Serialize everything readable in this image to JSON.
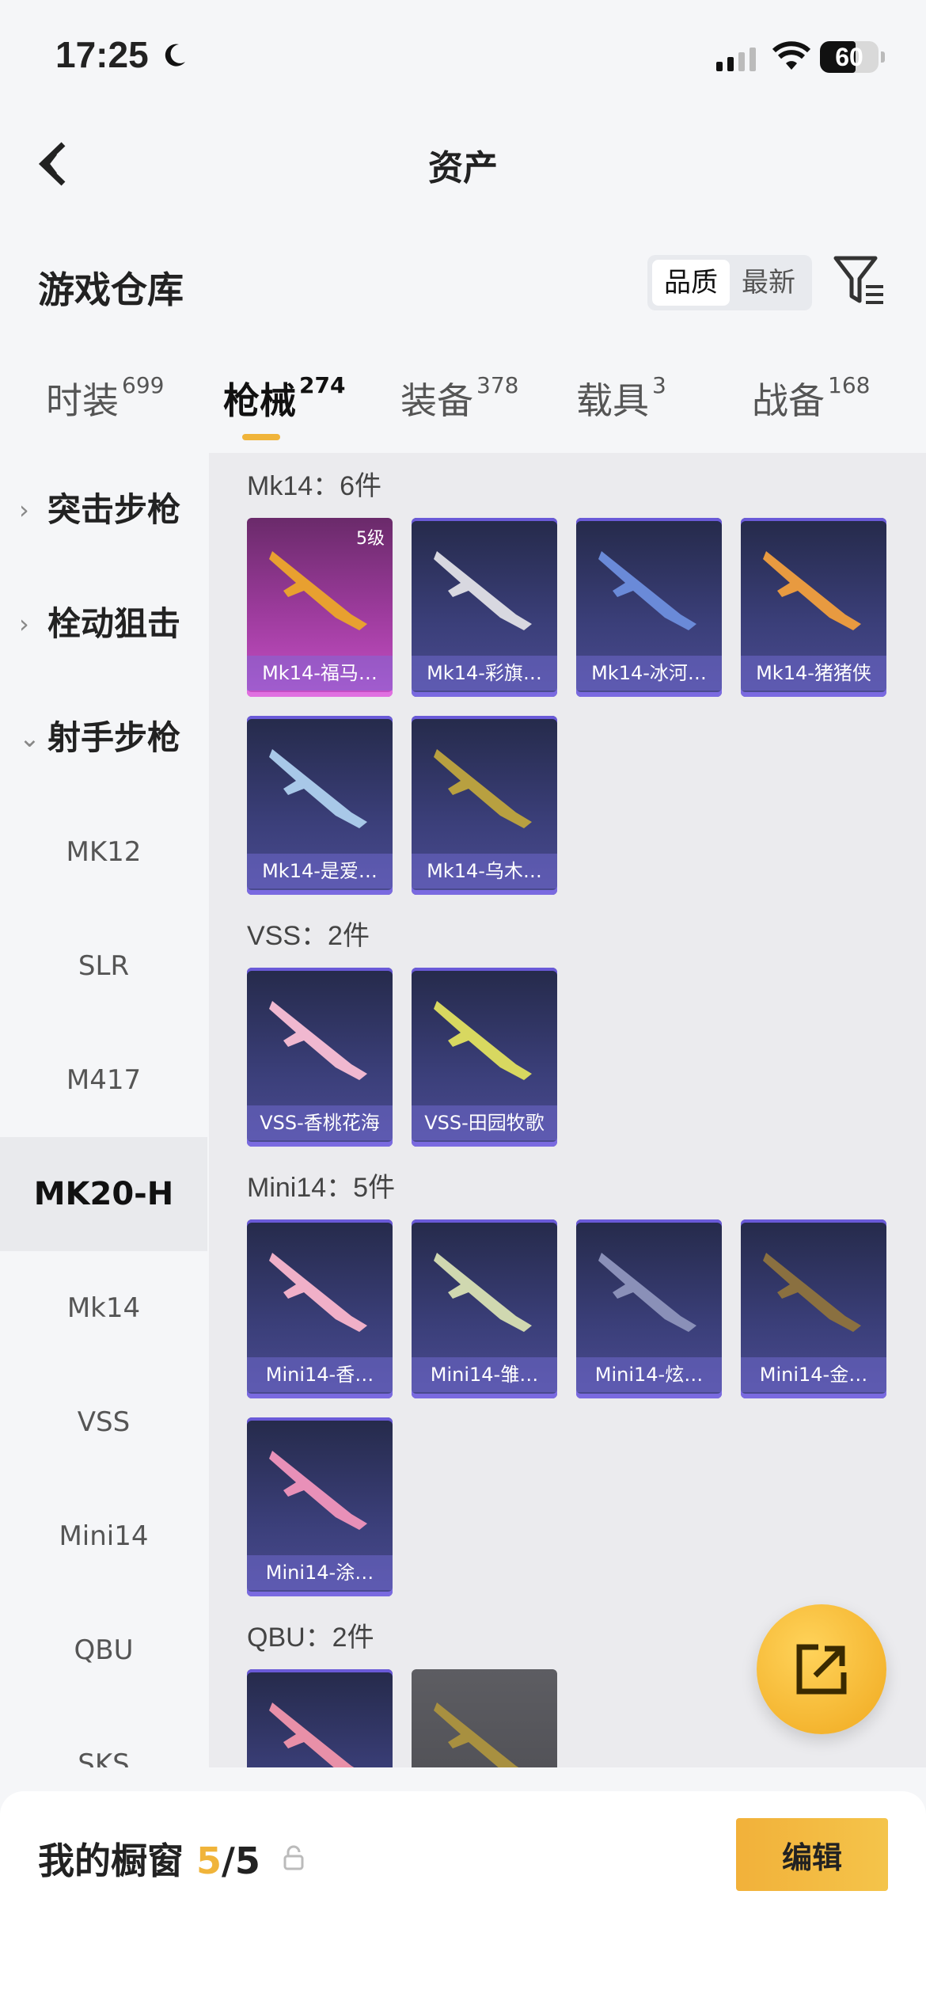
{
  "status_bar": {
    "time": "17:25",
    "battery": "60"
  },
  "nav": {
    "title": "资产"
  },
  "header": {
    "title": "游戏仓库",
    "sort_options": [
      "品质",
      "最新"
    ]
  },
  "tabs": [
    {
      "label": "时装",
      "count": "699"
    },
    {
      "label": "枪械",
      "count": "274"
    },
    {
      "label": "装备",
      "count": "378"
    },
    {
      "label": "载具",
      "count": "3"
    },
    {
      "label": "战备",
      "count": "168"
    }
  ],
  "sidebar": {
    "groups": [
      "突击步枪",
      "栓动狙击",
      "射手步枪"
    ],
    "items": [
      "MK12",
      "SLR",
      "M417",
      "MK20-H",
      "Mk14",
      "VSS",
      "Mini14",
      "QBU",
      "SKS"
    ]
  },
  "content": {
    "groups": [
      {
        "title": "Mk14：6件",
        "items": [
          {
            "name": "Mk14-福马…",
            "level": "5级"
          },
          {
            "name": "Mk14-彩旗…"
          },
          {
            "name": "Mk14-冰河…"
          },
          {
            "name": "Mk14-猪猪侠"
          },
          {
            "name": "Mk14-是爱…"
          },
          {
            "name": "Mk14-乌木…"
          }
        ]
      },
      {
        "title": "VSS：2件",
        "items": [
          {
            "name": "VSS-香桃花海"
          },
          {
            "name": "VSS-田园牧歌"
          }
        ]
      },
      {
        "title": "Mini14：5件",
        "items": [
          {
            "name": "Mini14-香…"
          },
          {
            "name": "Mini14-雏…"
          },
          {
            "name": "Mini14-炫…"
          },
          {
            "name": "Mini14-金…"
          },
          {
            "name": "Mini14-涂…"
          }
        ]
      },
      {
        "title": "QBU：2件",
        "items": []
      }
    ]
  },
  "showcase": {
    "label": "我的橱窗",
    "current": "5",
    "total": "/5",
    "edit_label": "编辑"
  },
  "colors": {
    "accent": "#f0b43a",
    "card_bg": "#3b3f7a",
    "card_pink": "#c64fc6"
  }
}
